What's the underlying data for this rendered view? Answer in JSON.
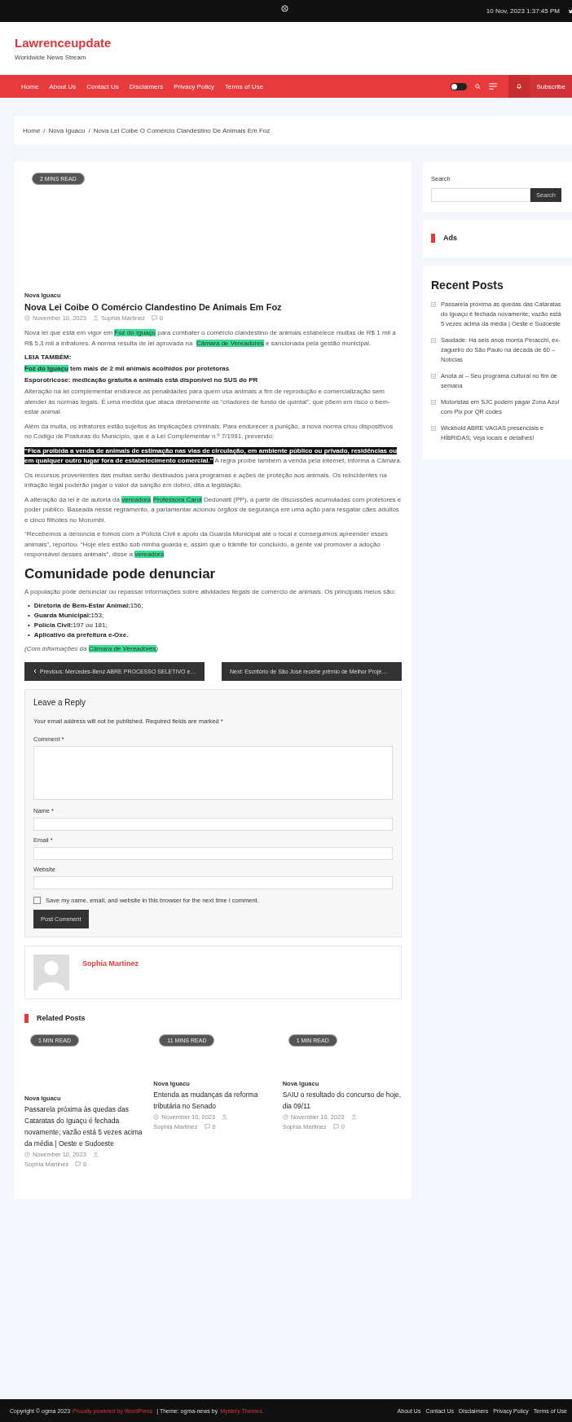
{
  "top_bar": {
    "datetime": "10 Nov, 2023 1:37:45 PM"
  },
  "site": {
    "title": "Lawrenceupdate",
    "tagline": "Worldwide News Stream"
  },
  "nav": {
    "items": [
      "Home",
      "About Us",
      "Contact Us",
      "Disclaimers",
      "Privacy Policy",
      "Terms of Use"
    ],
    "dark_mode": false,
    "subscribe": "Subscribe"
  },
  "breadcrumb": {
    "separator": "/",
    "items": [
      "Home",
      "Nova Iguacu",
      "Nova Lei Coibe O Comércio Clandestino De Animais Em Foz"
    ]
  },
  "article": {
    "read_time": "2 MINS READ",
    "category": "Nova Iguacu",
    "title": "Nova Lei Coibe O Comércio Clandestino De Animais Em Foz",
    "date": "November 10, 2023",
    "author": "Sophia Martinez",
    "comments": "0",
    "blocks": [
      {
        "kind": "paragraph",
        "segments": [
          {
            "kind": "text",
            "text": "Nova lei que está em vigor em "
          },
          {
            "kind": "link",
            "text": "Foz do Iguaçu"
          },
          {
            "kind": "text",
            "text": " para combater o comércio clandestino de animais estabelece multas de R$ 1 mil a R$ 5,3 mil a infratores. A norma resulta de lei aprovada na "
          },
          {
            "kind": "link",
            "text": "Câmara de Vereadores"
          },
          {
            "kind": "text",
            "text": " e sancionada pela gestão municipal."
          }
        ]
      },
      {
        "kind": "label",
        "segments": [
          {
            "kind": "text",
            "text": "LEIA TAMBÉM:"
          }
        ]
      },
      {
        "kind": "bold_line",
        "segments": [
          {
            "kind": "link",
            "text": "Foz do Iguaçu"
          },
          {
            "kind": "text",
            "text": " tem mais de 2 mil animais acolhidos por protetoras"
          }
        ]
      },
      {
        "kind": "bold_line",
        "segments": [
          {
            "kind": "text",
            "text": "Esporotricose: medicação gratuita a animais está disponível no SUS do PR"
          }
        ]
      },
      {
        "kind": "paragraph",
        "segments": [
          {
            "kind": "text",
            "text": "Alteração na lei complementar endurece as penalidades para quem usa animais a fim de reprodução e comercialização sem atender às normas legais. É uma medida que ataca diretamente os “criadores de fundo de quintal”, que põem em risco o bem-estar animal."
          }
        ]
      },
      {
        "kind": "paragraph",
        "segments": [
          {
            "kind": "text",
            "text": "Além da multa, os infratores estão sujeitos às implicações criminais. Para endurecer a punição, a nova norma criou dispositivos no Código de Posturas do Município, que é a Lei Complementar n.º 7/1991, prevendo:"
          }
        ]
      },
      {
        "kind": "paragraph",
        "segments": [
          {
            "kind": "mark",
            "text": "“Fica proibida a venda de animais de estimação nas vias de circulação, em ambiente público ou privado, residências ou em qualquer outro lugar fora de estabelecimento comercial.”"
          },
          {
            "kind": "text",
            "text": " A regra proíbe também a venda pela internet, informa a Câmara."
          }
        ]
      },
      {
        "kind": "paragraph",
        "segments": [
          {
            "kind": "text",
            "text": "Os recursos provenientes das multas serão destinados para programas e ações de proteção aos animais. Os reincidentes na infração legal poderão pagar o valor da sanção em dobro, dita a legislação."
          }
        ]
      },
      {
        "kind": "paragraph",
        "segments": [
          {
            "kind": "text",
            "text": "A alteração da lei é de autoria da "
          },
          {
            "kind": "link",
            "text": "vereadora"
          },
          {
            "kind": "link",
            "text": "Professora Carol"
          },
          {
            "kind": "text",
            "text": " Dedonatti (PP), a partir de discussões acumuladas com protetores e poder público. Baseada nesse regramento, a parlamentar acionou órgãos de segurança em uma ação para resgatar cães adultos e cinco filhotes no Morumbi."
          }
        ]
      },
      {
        "kind": "paragraph",
        "segments": [
          {
            "kind": "text",
            "text": "“Recebemos a denúncia e fomos com a Polícia Civil e apoio da Guarda Municipal até o local e conseguimos apreender esses animais”, reportou. “Hoje eles estão sob minha guarda e, assim que o trâmite for concluído, a gente vai promover a adoção responsável desses animais”, disse a "
          },
          {
            "kind": "link",
            "text": "vereadora"
          },
          {
            "kind": "text",
            "text": "."
          }
        ]
      },
      {
        "kind": "heading",
        "text": "Comunidade pode denunciar"
      },
      {
        "kind": "paragraph",
        "segments": [
          {
            "kind": "text",
            "text": "A população pode denunciar ou repassar informações sobre atividades ilegais de comércio de animais. Os principais meios são:"
          }
        ]
      },
      {
        "kind": "list",
        "marker": "•",
        "items": [
          {
            "label": "Diretoria de Bem-Estar Animal:",
            "value": "156;"
          },
          {
            "label": "Guarda Municipal:",
            "value": "153;"
          },
          {
            "label": "Polícia Civil:",
            "value": "197 ou 181;"
          },
          {
            "label": "Aplicativo da prefeitura e-Oxe."
          }
        ]
      },
      {
        "kind": "source",
        "segments": [
          {
            "kind": "text",
            "text": "(Com informações da "
          },
          {
            "kind": "link",
            "text": "Câmara de Vereadores"
          },
          {
            "kind": "text",
            "text": ")"
          }
        ]
      }
    ]
  },
  "post_nav": {
    "previous": "Previous: Mercedes-Benz ABRE PROCESSO SELETIVO e…",
    "next": "Next: Escritório de São José recebe prêmio de Melhor Proje…"
  },
  "comment_form": {
    "title": "Leave a Reply",
    "notice": "Your email address will not be published. Required fields are marked *",
    "fields": [
      {
        "kind": "textarea",
        "label": "Comment *"
      },
      {
        "kind": "input",
        "label": "Name *"
      },
      {
        "kind": "input",
        "label": "Email *"
      },
      {
        "kind": "input",
        "label": "Website"
      }
    ],
    "save_info": {
      "label": "Save my name, email, and website in this browser for the next time I comment.",
      "checked": false
    },
    "submit": "Post Comment"
  },
  "author_box": {
    "name": "Sophia Martinez"
  },
  "related": {
    "title": "Related Posts",
    "posts": [
      {
        "read_time": "1 MIN READ",
        "category": "Nova Iguacu",
        "title": "Passarela próxima às quedas das Cataratas do Iguaçu é fechada novamente; vazão está 5 vezes acima da média | Oeste e Sudoeste",
        "date": "November 10, 2023",
        "author": "Sophia Martinez",
        "comments": "0"
      },
      {
        "read_time": "11 MINS READ",
        "category": "Nova Iguacu",
        "title": "Entenda as mudanças da reforma tributária no Senado",
        "date": "November 10, 2023",
        "author": "Sophia Martinez",
        "comments": "0"
      },
      {
        "read_time": "1 MIN READ",
        "category": "Nova Iguacu",
        "title": "SAIU o resultado do concurso de hoje, dia 09/11",
        "date": "November 10, 2023",
        "author": "Sophia Martinez",
        "comments": "0"
      }
    ]
  },
  "sidebar": {
    "search": {
      "label": "Search",
      "button": "Search"
    },
    "ads": {
      "title": "Ads"
    },
    "recent": {
      "title": "Recent Posts",
      "items": [
        "Passarela próxima às quedas das Cataratas do Iguaçu é fechada novamente; vazão está 5 vezes acima da média | Oeste e Sudoeste",
        "Saudade: Há seis anos morria Peracchi, ex-zagueiro do São Paulo na década de 60 – Notícias",
        "Anota aí – Seu programa cultural no fim de semana",
        "Motoristas em SJC podem pagar Zona Azul com Pix por QR codes",
        "Wickbold ABRE VAGAS presenciais e HÍBRIDAS; Veja locais e detalhes!"
      ]
    }
  },
  "footer": {
    "segments": [
      {
        "kind": "text",
        "text": "Copyright © ogma 2023"
      },
      {
        "kind": "link",
        "text": "Proudly powered by WordPress"
      },
      {
        "kind": "text",
        "text": " | Theme: ogma-news by"
      },
      {
        "kind": "link",
        "text": "Mystery Themes."
      }
    ],
    "links": [
      "About Us",
      "Contact Us",
      "Disclaimers",
      "Privacy Policy",
      "Terms of Use"
    ]
  }
}
